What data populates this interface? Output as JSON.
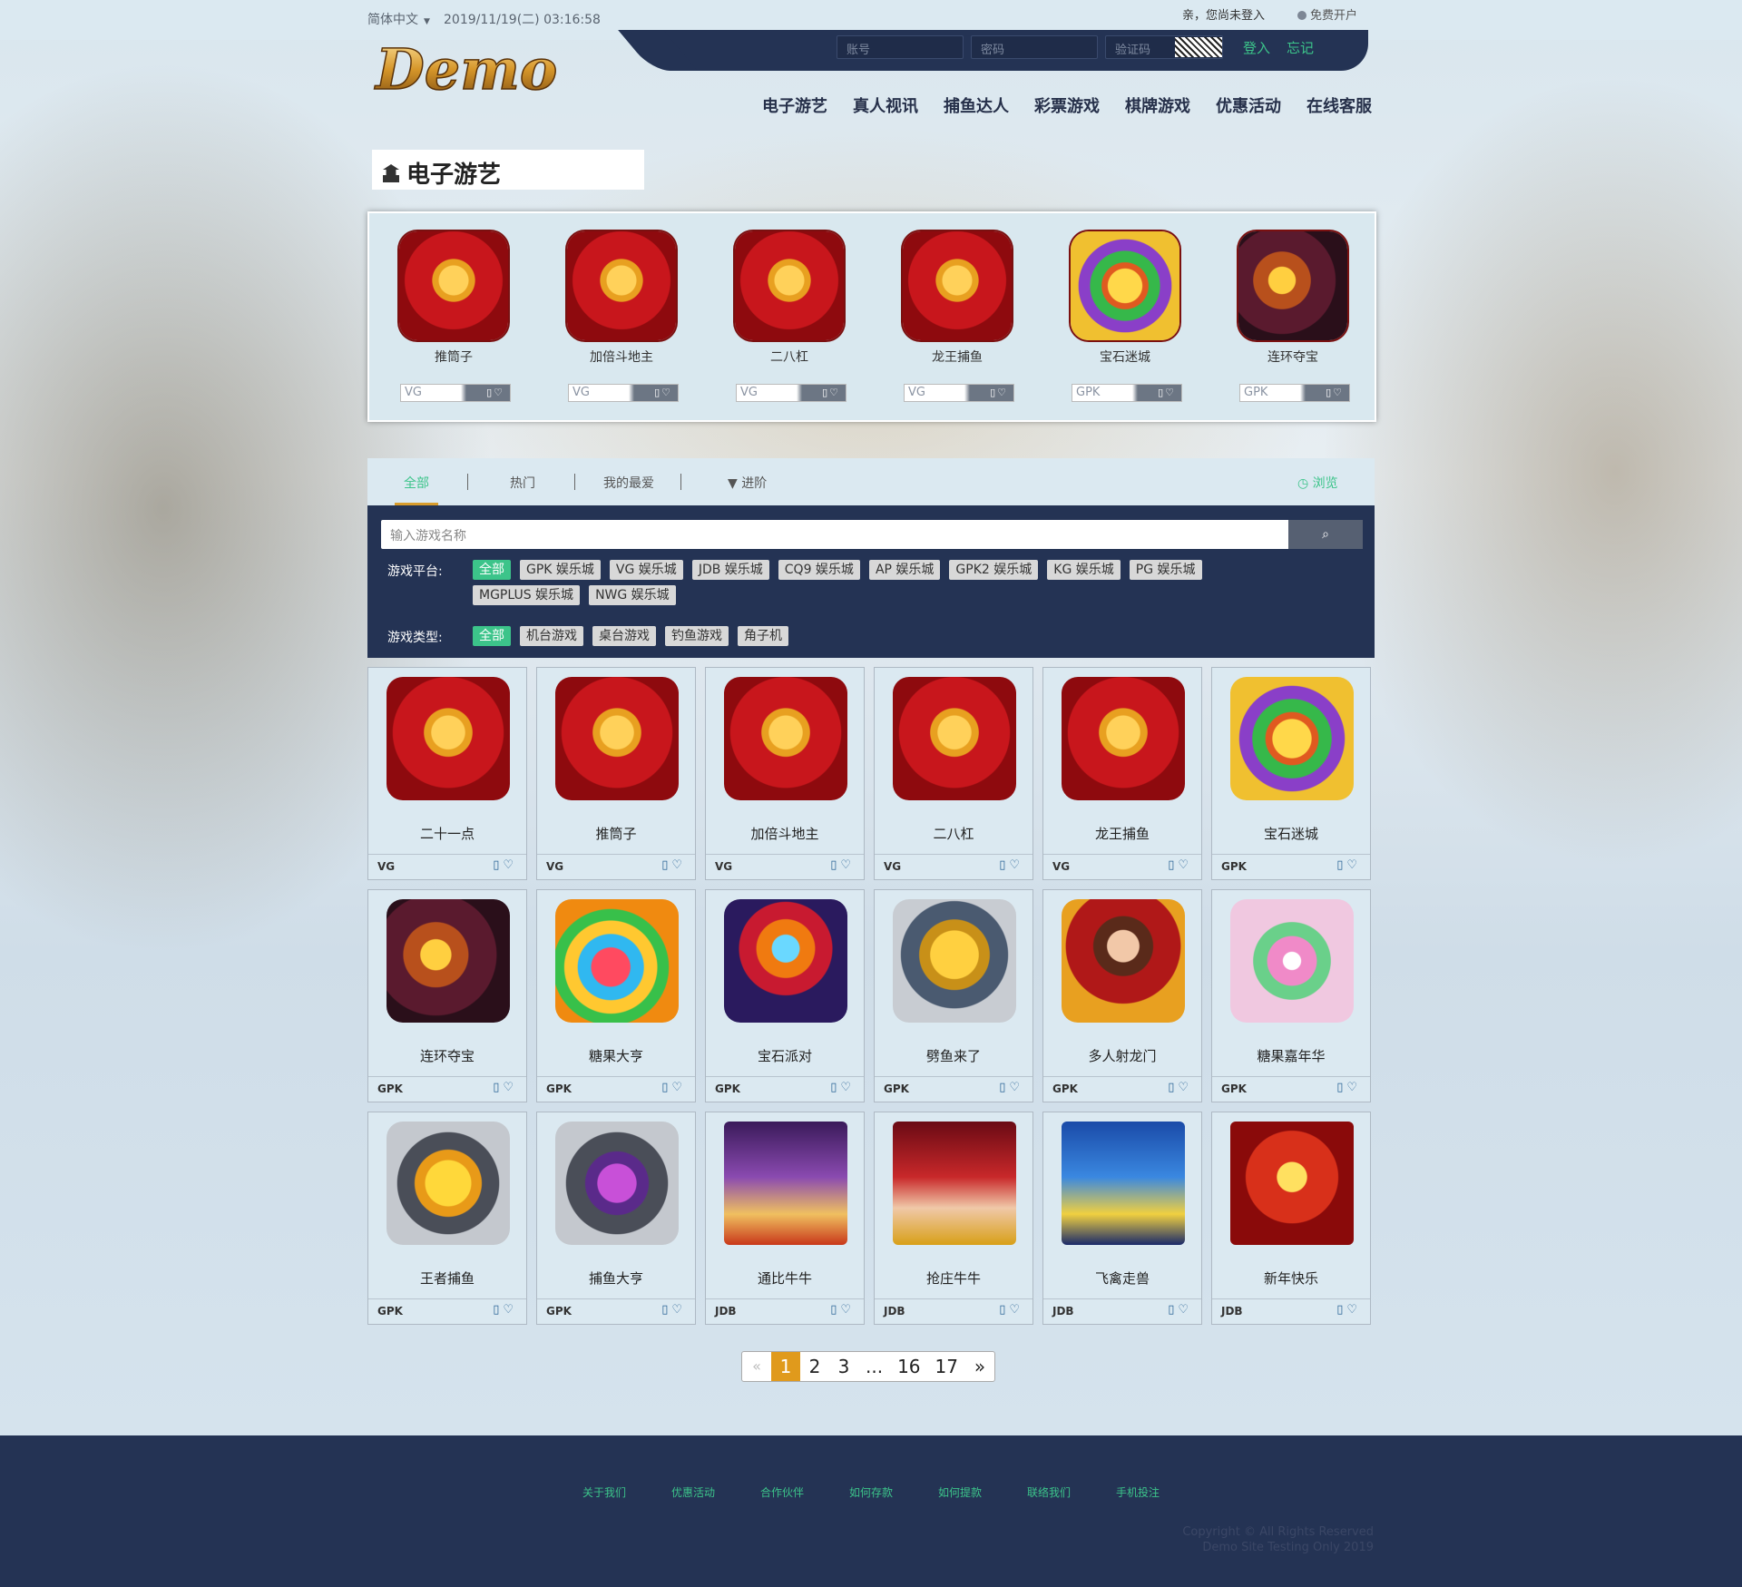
{
  "topbar": {
    "lang": "简体中文",
    "datetime": "2019/11/19(二) 03:16:58",
    "greeting": "亲，您尚未登入",
    "register": "免费开户"
  },
  "login": {
    "account_placeholder": "账号",
    "password_placeholder": "密码",
    "captcha_placeholder": "验证码",
    "login_label": "登入",
    "forgot_label": "忘记"
  },
  "logo": {
    "text": "Demo"
  },
  "nav": [
    "电子游艺",
    "真人视讯",
    "捕鱼达人",
    "彩票游戏",
    "棋牌游戏",
    "优惠活动",
    "在线客服"
  ],
  "section_title": "电子游艺",
  "featured": [
    {
      "name": "推筒子",
      "provider": "VG",
      "art": "casino"
    },
    {
      "name": "加倍斗地主",
      "provider": "VG",
      "art": "casino"
    },
    {
      "name": "二八杠",
      "provider": "VG",
      "art": "casino"
    },
    {
      "name": "龙王捕鱼",
      "provider": "VG",
      "art": "casino"
    },
    {
      "name": "宝石迷城",
      "provider": "GPK",
      "art": "fortune"
    },
    {
      "name": "连环夺宝",
      "provider": "GPK",
      "art": "dragon"
    }
  ],
  "tabs": {
    "all": "全部",
    "hot": "热门",
    "favorite": "我的最爱",
    "advanced": "进阶",
    "browse": "浏览"
  },
  "search": {
    "placeholder": "输入游戏名称"
  },
  "filters": {
    "platform_label": "游戏平台:",
    "platforms": [
      "全部",
      "GPK 娱乐城",
      "VG 娱乐城",
      "JDB 娱乐城",
      "CQ9 娱乐城",
      "AP 娱乐城",
      "GPK2 娱乐城",
      "KG 娱乐城",
      "PG 娱乐城",
      "MGPLUS 娱乐城",
      "NWG 娱乐城"
    ],
    "type_label": "游戏类型:",
    "types": [
      "全部",
      "机台游戏",
      "桌台游戏",
      "钓鱼游戏",
      "角子机"
    ]
  },
  "games": [
    {
      "name": "二十一点",
      "provider": "VG",
      "art": "casino"
    },
    {
      "name": "推筒子",
      "provider": "VG",
      "art": "casino"
    },
    {
      "name": "加倍斗地主",
      "provider": "VG",
      "art": "casino"
    },
    {
      "name": "二八杠",
      "provider": "VG",
      "art": "casino"
    },
    {
      "name": "龙王捕鱼",
      "provider": "VG",
      "art": "casino"
    },
    {
      "name": "宝石迷城",
      "provider": "GPK",
      "art": "fortune"
    },
    {
      "name": "连环夺宝",
      "provider": "GPK",
      "art": "dragon"
    },
    {
      "name": "糖果大亨",
      "provider": "GPK",
      "art": "candy"
    },
    {
      "name": "宝石派对",
      "provider": "GPK",
      "art": "gem"
    },
    {
      "name": "劈鱼来了",
      "provider": "GPK",
      "art": "fish"
    },
    {
      "name": "多人射龙门",
      "provider": "GPK",
      "art": "girl"
    },
    {
      "name": "糖果嘉年华",
      "provider": "GPK",
      "art": "carnival"
    },
    {
      "name": "王者捕鱼",
      "provider": "GPK",
      "art": "goldfish"
    },
    {
      "name": "捕鱼大亨",
      "provider": "GPK",
      "art": "pirate"
    },
    {
      "name": "通比牛牛",
      "provider": "JDB",
      "art": "poker"
    },
    {
      "name": "抢庄牛牛",
      "provider": "JDB",
      "art": "poker2"
    },
    {
      "name": "飞禽走兽",
      "provider": "JDB",
      "art": "animals"
    },
    {
      "name": "新年快乐",
      "provider": "JDB",
      "art": "newyear"
    }
  ],
  "pagination": [
    "«",
    "1",
    "2",
    "3",
    "...",
    "16",
    "17",
    "»"
  ],
  "footer": {
    "links": [
      "关于我们",
      "优惠活动",
      "合作伙伴",
      "如何存款",
      "如何提款",
      "联络我们",
      "手机投注"
    ],
    "copyright_1": "Copyright © All Rights Reserved",
    "copyright_2": "Demo Site Testing Only 2019"
  },
  "colors": {
    "navy": "#243354",
    "accent_green": "#3cc48a",
    "accent_orange": "#e09a1c",
    "panel": "#dbe9f1"
  }
}
